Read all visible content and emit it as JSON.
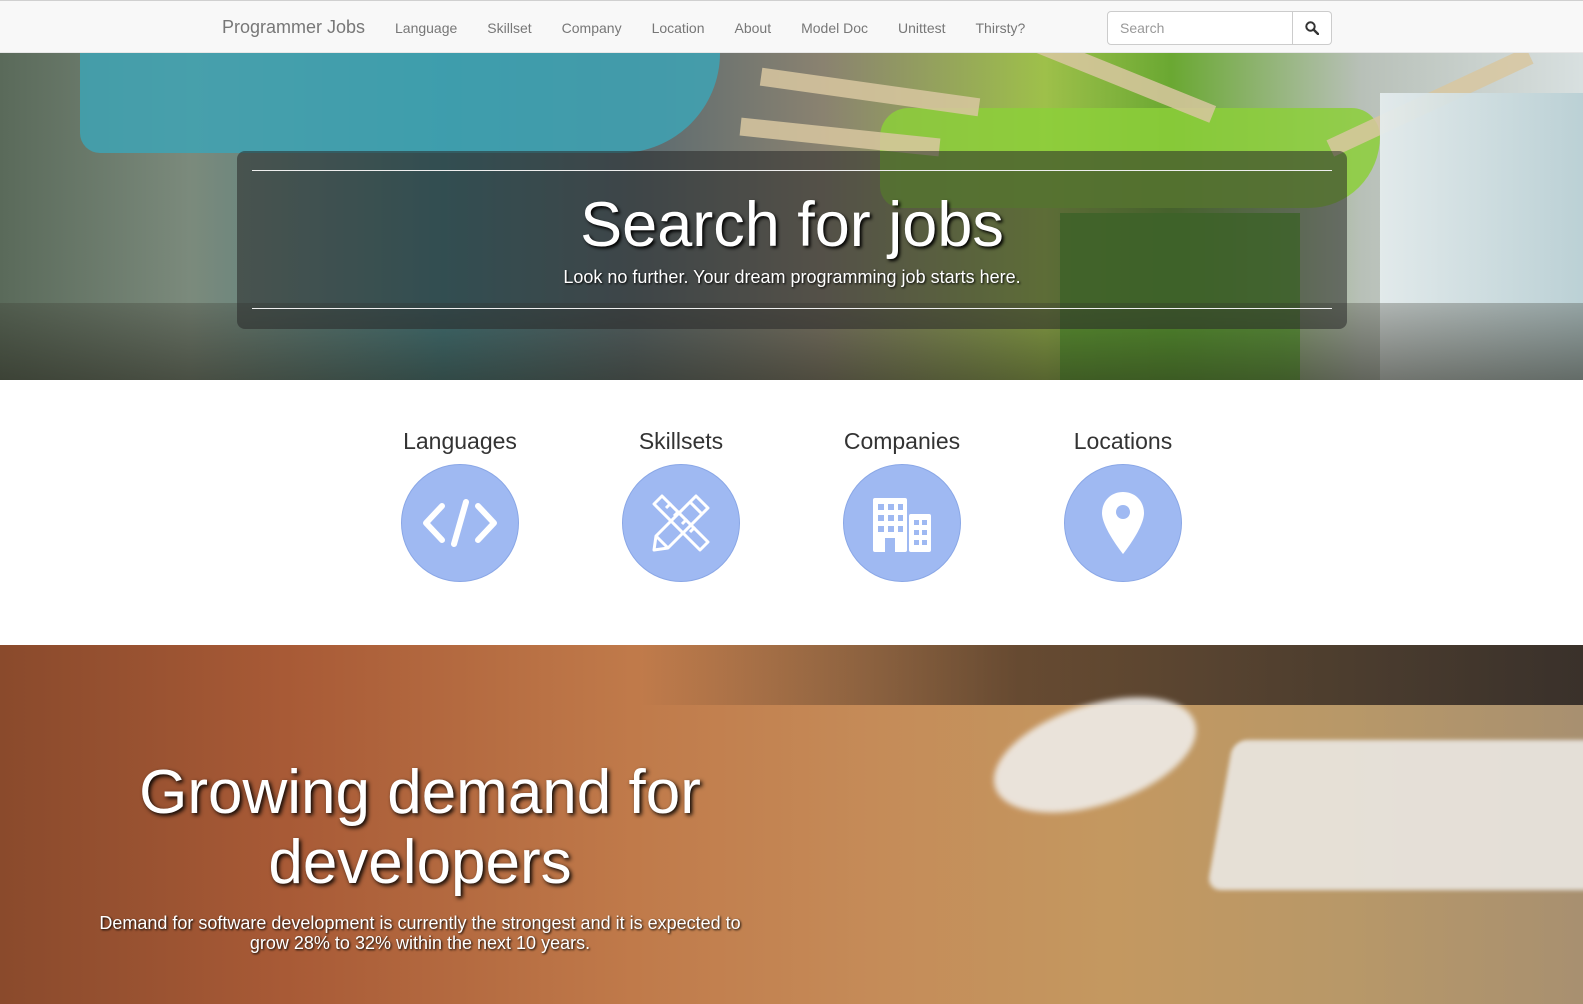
{
  "navbar": {
    "brand": "Programmer Jobs",
    "links": [
      "Language",
      "Skillset",
      "Company",
      "Location",
      "About",
      "Model Doc",
      "Unittest",
      "Thirsty?"
    ],
    "search": {
      "placeholder": "Search",
      "value": ""
    }
  },
  "hero": {
    "title": "Search for jobs",
    "subtitle": "Look no further. Your dream programming job starts here."
  },
  "categories": [
    {
      "label": "Languages",
      "icon": "code-icon"
    },
    {
      "label": "Skillsets",
      "icon": "pencil-ruler-icon"
    },
    {
      "label": "Companies",
      "icon": "buildings-icon"
    },
    {
      "label": "Locations",
      "icon": "map-pin-icon"
    }
  ],
  "demand": {
    "title": "Growing demand for developers",
    "text": "Demand for software development is currently the strongest and it is expected to grow 28% to 32% within the next 10 years."
  },
  "colors": {
    "category_circle": "#9fb9f2",
    "navbar_bg": "#f8f8f8",
    "nav_text": "#777777"
  }
}
